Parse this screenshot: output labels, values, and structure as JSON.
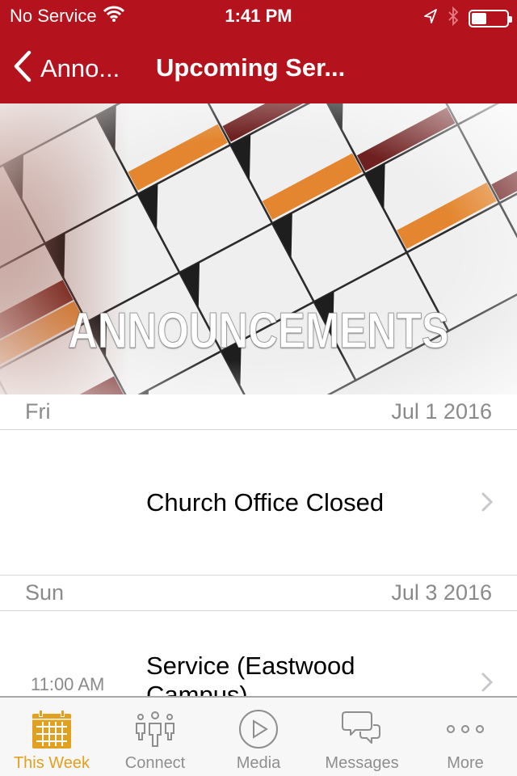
{
  "status_bar": {
    "carrier": "No Service",
    "time": "1:41 PM",
    "battery_level": 0.4,
    "icons": [
      "wifi-icon",
      "location-arrow-icon",
      "bluetooth-icon",
      "battery-icon"
    ]
  },
  "nav": {
    "back_label": "Anno...",
    "title": "Upcoming Ser..."
  },
  "hero": {
    "title": "ANNOUNCEMENTS"
  },
  "sections": [
    {
      "day": "Fri",
      "date": "Jul 1 2016",
      "items": [
        {
          "time": "",
          "title": "Church Office Closed"
        }
      ]
    },
    {
      "day": "Sun",
      "date": "Jul 3 2016",
      "items": [
        {
          "time": "11:00 AM",
          "title": "Service (Eastwood Campus)"
        }
      ]
    }
  ],
  "tab_bar": {
    "active_color": "#e0a121",
    "tabs": [
      {
        "label": "This Week",
        "icon": "calendar-icon",
        "active": true
      },
      {
        "label": "Connect",
        "icon": "people-icon",
        "active": false
      },
      {
        "label": "Media",
        "icon": "play-circle-icon",
        "active": false
      },
      {
        "label": "Messages",
        "icon": "chat-bubbles-icon",
        "active": false
      },
      {
        "label": "More",
        "icon": "more-dots-icon",
        "active": false
      }
    ]
  },
  "colors": {
    "header_bg": "#b4121d",
    "tab_active": "#e0a121",
    "tab_inactive": "#8e8e8e",
    "secondary_text": "#8a8a8a"
  }
}
